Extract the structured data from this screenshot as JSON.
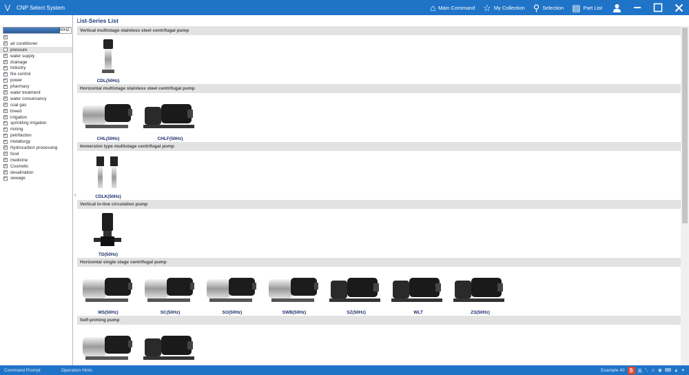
{
  "titlebar": {
    "app_title": "CNP Select System",
    "items": [
      {
        "label": "Main Command",
        "icon": "home-icon"
      },
      {
        "label": "My Collection",
        "icon": "star-icon"
      },
      {
        "label": "Selection",
        "icon": "search-icon"
      },
      {
        "label": "Part List",
        "icon": "book-icon"
      }
    ]
  },
  "left_panel": {
    "hz_value": "50HZ",
    "categories": [
      {
        "label": "",
        "checked": true,
        "selected": false
      },
      {
        "label": "air conditioner",
        "checked": true,
        "selected": false
      },
      {
        "label": "pressure",
        "checked": false,
        "selected": true
      },
      {
        "label": "water supply",
        "checked": true,
        "selected": false
      },
      {
        "label": "drainage",
        "checked": true,
        "selected": false
      },
      {
        "label": "Industry",
        "checked": true,
        "selected": false
      },
      {
        "label": "fire control",
        "checked": true,
        "selected": false
      },
      {
        "label": "power",
        "checked": true,
        "selected": false
      },
      {
        "label": "pharmacy",
        "checked": true,
        "selected": false
      },
      {
        "label": "water treatment",
        "checked": true,
        "selected": false
      },
      {
        "label": "water conservancy",
        "checked": true,
        "selected": false
      },
      {
        "label": "coal gas",
        "checked": true,
        "selected": false
      },
      {
        "label": "breed",
        "checked": true,
        "selected": false
      },
      {
        "label": "irrigation",
        "checked": true,
        "selected": false
      },
      {
        "label": "sprinkling irrigation",
        "checked": true,
        "selected": false
      },
      {
        "label": "mining",
        "checked": true,
        "selected": false
      },
      {
        "label": "petrifaction",
        "checked": true,
        "selected": false
      },
      {
        "label": "metallurgy",
        "checked": true,
        "selected": false
      },
      {
        "label": "Hydrocarbon processing",
        "checked": true,
        "selected": false
      },
      {
        "label": "food",
        "checked": true,
        "selected": false
      },
      {
        "label": "medicine",
        "checked": true,
        "selected": false
      },
      {
        "label": "Cosmetic",
        "checked": true,
        "selected": false
      },
      {
        "label": "desalination",
        "checked": true,
        "selected": false
      },
      {
        "label": "sewage",
        "checked": true,
        "selected": false
      }
    ]
  },
  "main": {
    "tab_title": "Part List-Series List",
    "sections": [
      {
        "title": "Vertical multistage stainless steel centrifugal pump",
        "products": [
          {
            "label": "CDL(50Hz)",
            "shape": "vertical"
          }
        ]
      },
      {
        "title": "Horizontal multistage stainless steel centrifugal pump",
        "products": [
          {
            "label": "CHL(50Hz)",
            "shape": "horizontal-steel"
          },
          {
            "label": "CHLF(50Hz)",
            "shape": "horizontal-black"
          }
        ]
      },
      {
        "title": "Immersion type multistage centrifugal pump",
        "products": [
          {
            "label": "CDLK(50Hz)",
            "shape": "immersion"
          }
        ]
      },
      {
        "title": "Vertical in-line circulation pump",
        "products": [
          {
            "label": "TD(50Hz)",
            "shape": "inline"
          }
        ]
      },
      {
        "title": "Horizontal single stage centrifugal pump",
        "products": [
          {
            "label": "MS(50Hz)",
            "shape": "horizontal-steel"
          },
          {
            "label": "SC(50Hz)",
            "shape": "horizontal-steel"
          },
          {
            "label": "SO(50Hz)",
            "shape": "horizontal-steel"
          },
          {
            "label": "SWB(50Hz)",
            "shape": "horizontal-steel"
          },
          {
            "label": "SZ(50Hz)",
            "shape": "horizontal-black"
          },
          {
            "label": "WLT",
            "shape": "horizontal-black"
          },
          {
            "label": "ZS(50Hz)",
            "shape": "horizontal-black"
          }
        ]
      },
      {
        "title": "Self-priming pump",
        "products": [
          {
            "label": "",
            "shape": "horizontal-steel"
          },
          {
            "label": "",
            "shape": "horizontal-black"
          }
        ]
      }
    ]
  },
  "statusbar": {
    "left_text_1": "Command Prompt",
    "left_text_2": "Operation Hints",
    "right_text": "Example 40",
    "ime_label": "英"
  },
  "colors": {
    "titlebar_bg": "#1f74c8",
    "section_header_bg": "#e2e2e2",
    "product_label": "#1b2c6b"
  }
}
